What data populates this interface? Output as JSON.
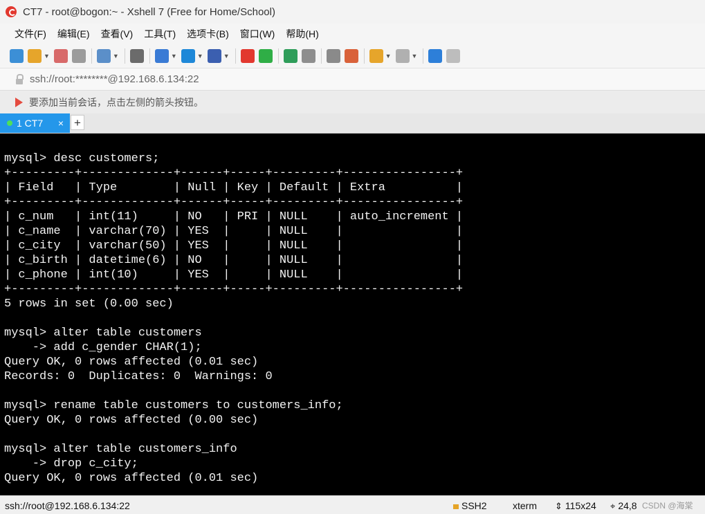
{
  "window": {
    "title": "CT7 - root@bogon:~ - Xshell 7 (Free for Home/School)"
  },
  "menu": [
    "文件(F)",
    "编辑(E)",
    "查看(V)",
    "工具(T)",
    "选项卡(B)",
    "窗口(W)",
    "帮助(H)"
  ],
  "toolbar": {
    "icons": [
      {
        "name": "new-session-icon",
        "color": "#3c8fd6",
        "caret": false
      },
      {
        "name": "open-folder-icon",
        "color": "#e6a52b",
        "caret": true
      },
      {
        "name": "reconnect-icon",
        "color": "#d86a6a",
        "caret": false
      },
      {
        "name": "disconnect-icon",
        "color": "#9c9c9c",
        "caret": false,
        "sep": true
      },
      {
        "name": "properties-icon",
        "color": "#5b8fc9",
        "caret": true,
        "sep": true
      },
      {
        "name": "find-icon",
        "color": "#6b6b6b",
        "caret": false,
        "sep": true
      },
      {
        "name": "transfer-icon",
        "color": "#3a7bd5",
        "caret": true
      },
      {
        "name": "globe-icon",
        "color": "#1e88d8",
        "caret": true
      },
      {
        "name": "font-icon",
        "color": "#3b5fb0",
        "caret": true,
        "sep": true
      },
      {
        "name": "xshell-icon",
        "color": "#e2382f",
        "caret": false
      },
      {
        "name": "xftp-icon",
        "color": "#2fae46",
        "caret": false,
        "sep": true
      },
      {
        "name": "fullscreen-icon",
        "color": "#2f9d5a",
        "caret": false
      },
      {
        "name": "lock-icon",
        "color": "#8e8e8e",
        "caret": false,
        "sep": true
      },
      {
        "name": "keyboard-icon",
        "color": "#8a8a8a",
        "caret": false
      },
      {
        "name": "compose-icon",
        "color": "#d9623a",
        "caret": false,
        "sep": true
      },
      {
        "name": "add-tab-icon",
        "color": "#e6a52b",
        "caret": true
      },
      {
        "name": "layout-icon",
        "color": "#b0b0b0",
        "caret": true,
        "sep": true
      },
      {
        "name": "help-icon",
        "color": "#2d7fd9",
        "caret": false
      },
      {
        "name": "chat-icon",
        "color": "#bdbdbd",
        "caret": false
      }
    ]
  },
  "address": {
    "text": "ssh://root:********@192.168.6.134:22"
  },
  "hint": {
    "text": "要添加当前会话，点击左侧的箭头按钮。"
  },
  "tabs": {
    "active_label": "1 CT7",
    "close_glyph": "×",
    "new_glyph": "+"
  },
  "terminal": {
    "lines": [
      "mysql> desc customers;",
      "+---------+-------------+------+-----+---------+----------------+",
      "| Field   | Type        | Null | Key | Default | Extra          |",
      "+---------+-------------+------+-----+---------+----------------+",
      "| c_num   | int(11)     | NO   | PRI | NULL    | auto_increment |",
      "| c_name  | varchar(70) | YES  |     | NULL    |                |",
      "| c_city  | varchar(50) | YES  |     | NULL    |                |",
      "| c_birth | datetime(6) | NO   |     | NULL    |                |",
      "| c_phone | int(10)     | YES  |     | NULL    |                |",
      "+---------+-------------+------+-----+---------+----------------+",
      "5 rows in set (0.00 sec)",
      "",
      "mysql> alter table customers",
      "    -> add c_gender CHAR(1);",
      "Query OK, 0 rows affected (0.01 sec)",
      "Records: 0  Duplicates: 0  Warnings: 0",
      "",
      "mysql> rename table customers to customers_info;",
      "Query OK, 0 rows affected (0.00 sec)",
      "",
      "mysql> alter table customers_info",
      "    -> drop c_city;",
      "Query OK, 0 rows affected (0.01 sec)"
    ]
  },
  "status": {
    "connection": "ssh://root@192.168.6.134:22",
    "protocol": "SSH2",
    "term": "xterm",
    "size": "115x24",
    "cursor": "24,8",
    "watermark": "CSDN @海棠"
  }
}
